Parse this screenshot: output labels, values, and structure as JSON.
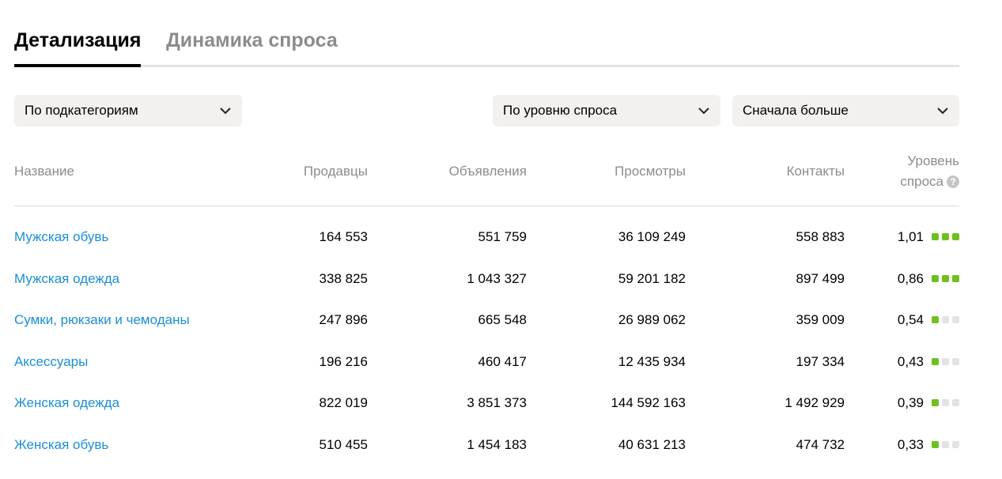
{
  "tabs": [
    {
      "label": "Детализация",
      "active": true
    },
    {
      "label": "Динамика спроса",
      "active": false
    }
  ],
  "filters": {
    "grouping": "По подкатегориям",
    "sort_field": "По уровню спроса",
    "sort_order": "Сначала больше"
  },
  "table": {
    "headers": {
      "name": "Название",
      "sellers": "Продавцы",
      "ads": "Объявления",
      "views": "Просмотры",
      "contacts": "Контакты",
      "level_line1": "Уровень",
      "level_line2": "спроса",
      "help": "?"
    },
    "rows": [
      {
        "name": "Мужская обувь",
        "sellers": "164 553",
        "ads": "551 759",
        "views": "36 109 249",
        "contacts": "558 883",
        "level": "1,01",
        "level_dots": 3
      },
      {
        "name": "Мужская одежда",
        "sellers": "338 825",
        "ads": "1 043 327",
        "views": "59 201 182",
        "contacts": "897 499",
        "level": "0,86",
        "level_dots": 3
      },
      {
        "name": "Сумки, рюкзаки и чемоданы",
        "sellers": "247 896",
        "ads": "665 548",
        "views": "26 989 062",
        "contacts": "359 009",
        "level": "0,54",
        "level_dots": 1
      },
      {
        "name": "Аксессуары",
        "sellers": "196 216",
        "ads": "460 417",
        "views": "12 435 934",
        "contacts": "197 334",
        "level": "0,43",
        "level_dots": 1
      },
      {
        "name": "Женская одежда",
        "sellers": "822 019",
        "ads": "3 851 373",
        "views": "144 592 163",
        "contacts": "1 492 929",
        "level": "0,39",
        "level_dots": 1
      },
      {
        "name": "Женская обувь",
        "sellers": "510 455",
        "ads": "1 454 183",
        "views": "40 631 213",
        "contacts": "474 732",
        "level": "0,33",
        "level_dots": 1
      }
    ]
  },
  "colors": {
    "link": "#1a8fd6",
    "level_on": "#6fbf1f",
    "level_off": "#e3e3e3"
  }
}
